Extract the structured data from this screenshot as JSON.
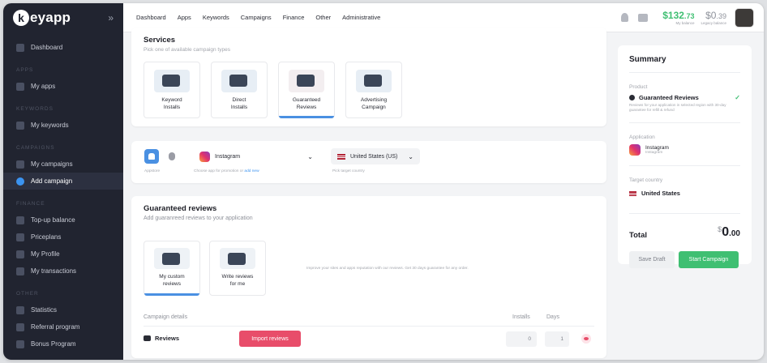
{
  "brand": {
    "logo_letter": "k",
    "logo_rest": "eyapp",
    "collapse": "»"
  },
  "sidebar": {
    "dashboard": "Dashboard",
    "sections": [
      {
        "title": "APPS",
        "items": [
          "My apps"
        ]
      },
      {
        "title": "KEYWORDS",
        "items": [
          "My keywords"
        ]
      },
      {
        "title": "CAMPAIGNS",
        "items": [
          "My campaigns",
          "Add campaign"
        ]
      },
      {
        "title": "FINANCE",
        "items": [
          "Top-up balance",
          "Priceplans",
          "My Profile",
          "My transactions"
        ]
      },
      {
        "title": "OTHER",
        "items": [
          "Statistics",
          "Referral program",
          "Bonus Program"
        ]
      }
    ]
  },
  "topnav": [
    "Dashboard",
    "Apps",
    "Keywords",
    "Campaigns",
    "Finance",
    "Other",
    "Administrative"
  ],
  "balance": {
    "main": "$132",
    "main_cents": ".73",
    "main_caption": "My balance",
    "legacy": "$0",
    "legacy_cents": ".39",
    "legacy_caption": "Legacy balance"
  },
  "services": {
    "title": "Services",
    "subtitle": "Pick one of available campaign types",
    "items": [
      {
        "line1": "Keyword",
        "line2": "Installs"
      },
      {
        "line1": "Direct",
        "line2": "Installs"
      },
      {
        "line1": "Guaranteed",
        "line2": "Reviews"
      },
      {
        "line1": "Advertising",
        "line2": "Campaign"
      }
    ]
  },
  "app_select": {
    "platform_caption": "Appstore",
    "app_name": "Instagram",
    "app_caption_prefix": "Choose app for promotion or ",
    "app_caption_link": "add new",
    "country": "United States (US)",
    "country_caption": "Pick target country"
  },
  "reviews": {
    "title": "Guaranteed reviews",
    "subtitle": "Add guaranreed reviews to your application",
    "options": [
      {
        "line1": "My custom",
        "line2": "reviews"
      },
      {
        "line1": "Write reviews",
        "line2": "for me"
      }
    ],
    "info": "Improve your sites and apps reputation with our reviews. Get 30 days guarantee for any order.",
    "details_label": "Campaign details",
    "col_installs": "Installs",
    "col_days": "Days",
    "row_label": "Reviews",
    "import_button": "Import reviews",
    "installs_value": "0",
    "days_value": "1"
  },
  "summary": {
    "title": "Summary",
    "product_label": "Product",
    "product_name": "Guaranteed Reviews",
    "product_desc": "Reviews for your application in selected region with 30-day guarantee for refill & refund",
    "application_label": "Application",
    "app_name": "Instagram",
    "app_sub": "Instagram",
    "country_label": "Target country",
    "country_name": "United States",
    "total_label": "Total",
    "total_currency": "$",
    "total_int": "0",
    "total_dec": ".00",
    "save_draft": "Save Draft",
    "start": "Start Campaign"
  },
  "colors": {
    "accent": "#4a90e2",
    "green": "#3fbf72",
    "red": "#e84d6a",
    "sidebar": "#212430"
  }
}
